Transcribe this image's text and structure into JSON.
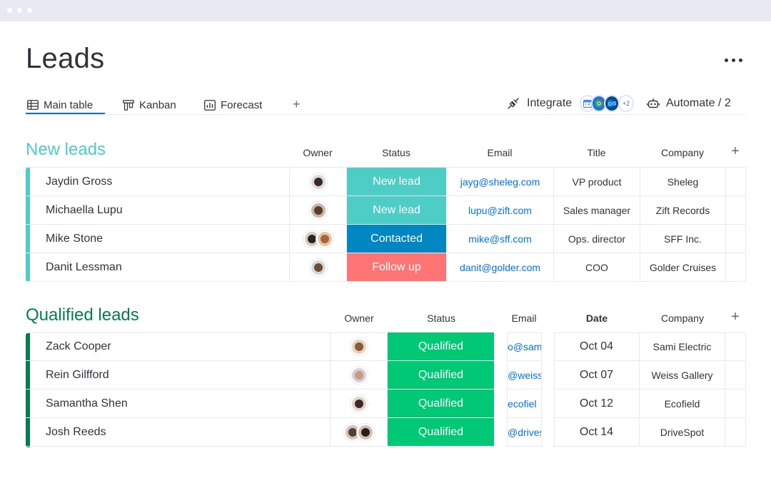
{
  "page": {
    "title": "Leads"
  },
  "tabs": [
    {
      "label": "Main table",
      "icon": "table-icon",
      "active": true
    },
    {
      "label": "Kanban",
      "icon": "kanban-icon",
      "active": false
    },
    {
      "label": "Forecast",
      "icon": "chart-icon",
      "active": false
    }
  ],
  "toolbar": {
    "integrate_label": "Integrate",
    "integration_more": "+2",
    "automate_label": "Automate / 2"
  },
  "colors": {
    "new_leads": "#4ecccc",
    "qualified_leads": "#037f4c",
    "status_new_lead": "#4eccc6",
    "status_contacted": "#0086c0",
    "status_follow_up": "#ff7575",
    "status_qualified": "#00c875",
    "link": "#0073ea"
  },
  "groups": {
    "new_leads": {
      "title": "New leads",
      "columns": [
        "Owner",
        "Status",
        "Email",
        "Title",
        "Company"
      ],
      "rows": [
        {
          "name": "Jaydin Gross",
          "status": "New lead",
          "email": "jayg@sheleg.com",
          "title": "VP product",
          "company": "Sheleg"
        },
        {
          "name": "Michaella Lupu",
          "status": "New lead",
          "email": "lupu@zift.com",
          "title": "Sales manager",
          "company": "Zift Records"
        },
        {
          "name": "Mike Stone",
          "status": "Contacted",
          "email": "mike@sff.com",
          "title": "Ops. director",
          "company": "SFF Inc."
        },
        {
          "name": "Danit Lessman",
          "status": "Follow up",
          "email": "danit@golder.com",
          "title": "COO",
          "company": "Golder Cruises"
        }
      ]
    },
    "qualified_leads": {
      "title": "Qualified leads",
      "columns": [
        "Owner",
        "Status",
        "Email",
        "Date",
        "Company"
      ],
      "rows": [
        {
          "name": "Zack Cooper",
          "status": "Qualified",
          "email": "o@sam",
          "date": "Oct 04",
          "company": "Sami Electric"
        },
        {
          "name": "Rein Gilfford",
          "status": "Qualified",
          "email": "@weiss",
          "date": "Oct 07",
          "company": "Weiss Gallery"
        },
        {
          "name": "Samantha Shen",
          "status": "Qualified",
          "email": "ecofiel",
          "date": "Oct 12",
          "company": "Ecofield"
        },
        {
          "name": "Josh Reeds",
          "status": "Qualified",
          "email": "@drivesp",
          "date": "Oct 14",
          "company": "DriveSpot"
        }
      ]
    }
  }
}
